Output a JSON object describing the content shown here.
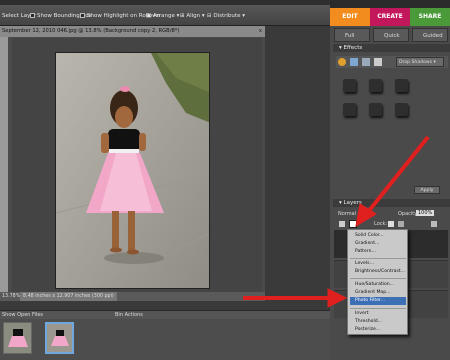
{
  "options_bar": {
    "select_layer": "Select Layer",
    "show_bounding_box": "Show Bounding Box",
    "show_highlight": "Show Highlight on Rollover",
    "arrange": "Arrange",
    "align": "Align",
    "distribute": "Distribute"
  },
  "mode_tabs": {
    "edit": "EDIT",
    "create": "CREATE",
    "share": "SHARE"
  },
  "edit_modes": {
    "full": "Full",
    "quick": "Quick",
    "guided": "Guided"
  },
  "document": {
    "title": "September 12, 2010 046.jpg @ 13.8% (Background copy 2, RGB/8*)",
    "close": "x",
    "zoom": "13.78%",
    "dimensions": "8.48 inches x 12.907 inches (300 ppi)"
  },
  "effects": {
    "header": "Effects",
    "dropdown": "Drop Shadows",
    "apply": "Apply"
  },
  "layers": {
    "header": "Layers",
    "blend_mode": "Normal",
    "opacity_label": "Opacity:",
    "opacity_value": "100%",
    "lock_label": "Lock:"
  },
  "adjustment_menu": {
    "items": [
      "Solid Color...",
      "Gradient...",
      "Pattern...",
      "Levels...",
      "Brightness/Contrast...",
      "Hue/Saturation...",
      "Gradient Map...",
      "Photo Filter...",
      "Invert",
      "Threshold...",
      "Posterize..."
    ],
    "highlighted": "Photo Filter..."
  },
  "project_bin": {
    "show_label": "Show Open Files",
    "bin_actions": "Bin Actions"
  },
  "colors": {
    "edit_tab": "#f28c1e",
    "create_tab": "#c2185b",
    "share_tab": "#4a9a3a",
    "arrow": "#e0201e"
  }
}
